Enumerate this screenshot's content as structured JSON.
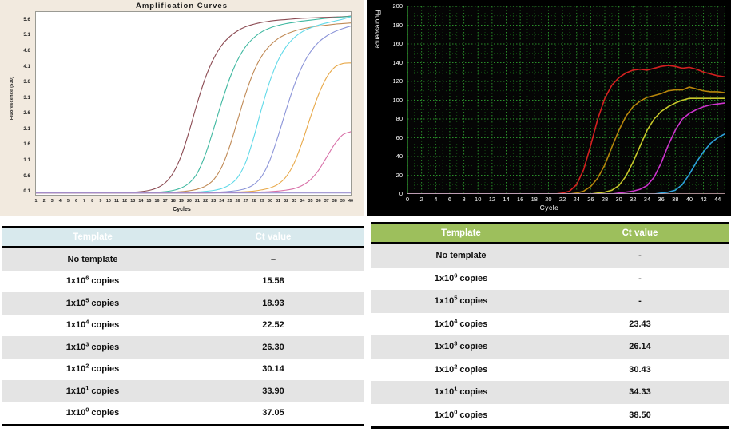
{
  "left": {
    "chart": {
      "title": "Amplification Curves",
      "xlabel": "Cycles",
      "ylabel": "Fluorescence (530)"
    },
    "table": {
      "headers": [
        "Template",
        "Ct value"
      ],
      "rows": [
        {
          "template_base": "No template",
          "template_exp": "",
          "template_suffix": "",
          "ct": "–"
        },
        {
          "template_base": "1x10",
          "template_exp": "6",
          "template_suffix": " copies",
          "ct": "15.58"
        },
        {
          "template_base": "1x10",
          "template_exp": "5",
          "template_suffix": " copies",
          "ct": "18.93"
        },
        {
          "template_base": "1x10",
          "template_exp": "4",
          "template_suffix": " copies",
          "ct": "22.52"
        },
        {
          "template_base": "1x10",
          "template_exp": "3",
          "template_suffix": " copies",
          "ct": "26.30"
        },
        {
          "template_base": "1x10",
          "template_exp": "2",
          "template_suffix": " copies",
          "ct": "30.14"
        },
        {
          "template_base": "1x10",
          "template_exp": "1",
          "template_suffix": " copies",
          "ct": "33.90"
        },
        {
          "template_base": "1x10",
          "template_exp": "0",
          "template_suffix": " copies",
          "ct": "37.05"
        }
      ],
      "header_bg": "#d8e9ed",
      "header_text_color": "#ffffff"
    }
  },
  "right": {
    "chart": {
      "title": "",
      "xlabel": "Cycle",
      "ylabel": "Fluorescence"
    },
    "table": {
      "headers": [
        "Template",
        "Ct value"
      ],
      "rows": [
        {
          "template_base": "No  template",
          "template_exp": "",
          "template_suffix": "",
          "ct": "-"
        },
        {
          "template_base": "1x10",
          "template_exp": "6",
          "template_suffix": " copies",
          "ct": "-"
        },
        {
          "template_base": "1x10",
          "template_exp": "5",
          "template_suffix": " copies",
          "ct": "-"
        },
        {
          "template_base": "1x10",
          "template_exp": "4",
          "template_suffix": " copies",
          "ct": "23.43"
        },
        {
          "template_base": "1x10",
          "template_exp": "3",
          "template_suffix": " copies",
          "ct": "26.14"
        },
        {
          "template_base": "1x10",
          "template_exp": "2",
          "template_suffix": " copies",
          "ct": "30.43"
        },
        {
          "template_base": "1x10",
          "template_exp": "1",
          "template_suffix": " copies",
          "ct": "34.33"
        },
        {
          "template_base": "1x10",
          "template_exp": "0",
          "template_suffix": " copies",
          "ct": "38.50"
        }
      ],
      "header_bg": "#9dbf5c",
      "header_text_color": "#ffffff"
    }
  },
  "chart_data": [
    {
      "type": "line",
      "id": "left-amplification-curves",
      "title": "Amplification Curves",
      "xlabel": "Cycles",
      "ylabel": "Fluorescence (530)",
      "xlim": [
        1,
        40
      ],
      "ylim": [
        0.0,
        5.85
      ],
      "grid": false,
      "legend": "none",
      "background": "#ffffff",
      "panel_background": "#f2eadf",
      "xticks": [
        1,
        2,
        3,
        4,
        5,
        6,
        7,
        8,
        9,
        10,
        11,
        12,
        13,
        14,
        15,
        16,
        17,
        18,
        19,
        20,
        21,
        22,
        23,
        24,
        25,
        26,
        27,
        28,
        29,
        30,
        31,
        32,
        33,
        34,
        35,
        36,
        37,
        38,
        39,
        40
      ],
      "yticks": [
        0.1,
        0.6,
        1.1,
        1.6,
        2.1,
        2.6,
        3.1,
        3.6,
        4.1,
        4.6,
        5.1,
        5.6
      ],
      "x": [
        1,
        2,
        3,
        4,
        5,
        6,
        7,
        8,
        9,
        10,
        11,
        12,
        13,
        14,
        15,
        16,
        17,
        18,
        19,
        20,
        21,
        22,
        23,
        24,
        25,
        26,
        27,
        28,
        29,
        30,
        31,
        32,
        33,
        34,
        35,
        36,
        37,
        38,
        39,
        40
      ],
      "series": [
        {
          "name": "1x10^6 copies",
          "color": "#8b4a52",
          "ct": 15.58,
          "values": [
            0.06,
            0.06,
            0.06,
            0.06,
            0.06,
            0.06,
            0.06,
            0.06,
            0.06,
            0.06,
            0.06,
            0.07,
            0.08,
            0.1,
            0.14,
            0.22,
            0.38,
            0.7,
            1.25,
            2.05,
            2.95,
            3.75,
            4.35,
            4.78,
            5.06,
            5.25,
            5.38,
            5.46,
            5.52,
            5.56,
            5.59,
            5.61,
            5.63,
            5.65,
            5.66,
            5.67,
            5.68,
            5.69,
            5.7,
            5.72
          ]
        },
        {
          "name": "1x10^5 copies",
          "color": "#3fb8a0",
          "ct": 18.93,
          "values": [
            0.06,
            0.06,
            0.06,
            0.06,
            0.06,
            0.06,
            0.06,
            0.06,
            0.06,
            0.06,
            0.06,
            0.06,
            0.06,
            0.06,
            0.07,
            0.08,
            0.1,
            0.14,
            0.22,
            0.38,
            0.7,
            1.3,
            2.1,
            2.95,
            3.72,
            4.32,
            4.75,
            5.03,
            5.22,
            5.34,
            5.42,
            5.48,
            5.52,
            5.56,
            5.59,
            5.62,
            5.65,
            5.67,
            5.69,
            5.71
          ]
        },
        {
          "name": "1x10^4 copies",
          "color": "#c08a56",
          "ct": 22.52,
          "values": [
            0.06,
            0.06,
            0.06,
            0.06,
            0.06,
            0.06,
            0.06,
            0.06,
            0.06,
            0.06,
            0.06,
            0.06,
            0.06,
            0.06,
            0.06,
            0.06,
            0.07,
            0.08,
            0.1,
            0.13,
            0.18,
            0.28,
            0.48,
            0.88,
            1.55,
            2.4,
            3.25,
            3.95,
            4.45,
            4.78,
            5.0,
            5.14,
            5.24,
            5.31,
            5.36,
            5.4,
            5.43,
            5.46,
            5.48,
            5.5
          ]
        },
        {
          "name": "1x10^3 copies",
          "color": "#5fd9e8",
          "ct": 26.3,
          "values": [
            0.06,
            0.06,
            0.06,
            0.06,
            0.06,
            0.06,
            0.06,
            0.06,
            0.06,
            0.06,
            0.06,
            0.06,
            0.06,
            0.06,
            0.06,
            0.06,
            0.06,
            0.06,
            0.07,
            0.08,
            0.09,
            0.11,
            0.14,
            0.2,
            0.32,
            0.56,
            1.05,
            1.85,
            2.8,
            3.65,
            4.3,
            4.74,
            5.03,
            5.22,
            5.34,
            5.43,
            5.5,
            5.56,
            5.62,
            5.7
          ]
        },
        {
          "name": "1x10^2 copies",
          "color": "#8b94d8",
          "ct": 30.14,
          "values": [
            0.06,
            0.06,
            0.06,
            0.06,
            0.06,
            0.06,
            0.06,
            0.06,
            0.06,
            0.06,
            0.06,
            0.06,
            0.06,
            0.06,
            0.06,
            0.06,
            0.06,
            0.06,
            0.06,
            0.06,
            0.07,
            0.07,
            0.08,
            0.09,
            0.11,
            0.14,
            0.2,
            0.33,
            0.6,
            1.12,
            1.88,
            2.72,
            3.5,
            4.12,
            4.57,
            4.88,
            5.08,
            5.22,
            5.32,
            5.4
          ]
        },
        {
          "name": "1x10^1 copies",
          "color": "#e8a94a",
          "ct": 33.9,
          "values": [
            0.06,
            0.06,
            0.06,
            0.06,
            0.06,
            0.06,
            0.06,
            0.06,
            0.06,
            0.06,
            0.06,
            0.06,
            0.06,
            0.06,
            0.06,
            0.06,
            0.06,
            0.06,
            0.06,
            0.06,
            0.06,
            0.06,
            0.07,
            0.07,
            0.08,
            0.09,
            0.1,
            0.12,
            0.16,
            0.22,
            0.34,
            0.58,
            1.02,
            1.7,
            2.48,
            3.2,
            3.75,
            4.08,
            4.2,
            4.22
          ]
        },
        {
          "name": "1x10^0 copies",
          "color": "#d870a8",
          "ct": 37.05,
          "values": [
            0.06,
            0.06,
            0.06,
            0.06,
            0.06,
            0.06,
            0.06,
            0.06,
            0.06,
            0.06,
            0.06,
            0.06,
            0.06,
            0.06,
            0.06,
            0.06,
            0.06,
            0.06,
            0.06,
            0.06,
            0.06,
            0.06,
            0.06,
            0.07,
            0.07,
            0.07,
            0.08,
            0.08,
            0.09,
            0.1,
            0.12,
            0.15,
            0.2,
            0.3,
            0.48,
            0.78,
            1.2,
            1.62,
            1.92,
            2.02
          ]
        },
        {
          "name": "No template",
          "color": "#9a8fcf",
          "ct": null,
          "values": [
            0.06,
            0.06,
            0.06,
            0.06,
            0.06,
            0.06,
            0.06,
            0.06,
            0.06,
            0.06,
            0.06,
            0.06,
            0.06,
            0.06,
            0.06,
            0.06,
            0.06,
            0.06,
            0.06,
            0.06,
            0.06,
            0.06,
            0.06,
            0.06,
            0.06,
            0.06,
            0.06,
            0.06,
            0.06,
            0.06,
            0.06,
            0.06,
            0.06,
            0.06,
            0.06,
            0.06,
            0.06,
            0.06,
            0.06,
            0.06
          ]
        }
      ]
    },
    {
      "type": "line",
      "id": "right-amplification-curves",
      "title": "",
      "xlabel": "Cycle",
      "ylabel": "Fluorescence",
      "xlim": [
        0,
        45
      ],
      "ylim": [
        0,
        200
      ],
      "grid": true,
      "grid_color": "#1f7a1f",
      "grid_style": "dotted",
      "legend": "none",
      "background": "#000000",
      "xticks": [
        0,
        2,
        4,
        6,
        8,
        10,
        12,
        14,
        16,
        18,
        20,
        22,
        24,
        26,
        28,
        30,
        32,
        34,
        36,
        38,
        40,
        42,
        44
      ],
      "yticks": [
        0,
        20,
        40,
        60,
        80,
        100,
        120,
        140,
        160,
        180,
        200
      ],
      "x": [
        0,
        1,
        2,
        3,
        4,
        5,
        6,
        7,
        8,
        9,
        10,
        11,
        12,
        13,
        14,
        15,
        16,
        17,
        18,
        19,
        20,
        21,
        22,
        23,
        24,
        25,
        26,
        27,
        28,
        29,
        30,
        31,
        32,
        33,
        34,
        35,
        36,
        37,
        38,
        39,
        40,
        41,
        42,
        43,
        44,
        45
      ],
      "series": [
        {
          "name": "1x10^4 copies",
          "color": "#d42020",
          "ct": 23.43,
          "values": [
            0,
            0,
            0,
            0,
            0,
            0,
            0,
            0,
            0,
            0,
            0,
            0,
            0,
            0,
            0,
            0,
            0,
            0,
            0,
            0,
            0,
            0,
            1,
            3,
            10,
            26,
            52,
            80,
            102,
            116,
            124,
            129,
            132,
            133,
            132,
            134,
            136,
            137,
            136,
            134,
            135,
            133,
            130,
            128,
            126,
            125
          ]
        },
        {
          "name": "1x10^3 copies",
          "color": "#b8860b",
          "ct": 26.14,
          "values": [
            0,
            0,
            0,
            0,
            0,
            0,
            0,
            0,
            0,
            0,
            0,
            0,
            0,
            0,
            0,
            0,
            0,
            0,
            0,
            0,
            0,
            0,
            0,
            0,
            1,
            3,
            8,
            17,
            31,
            50,
            68,
            83,
            93,
            99,
            103,
            105,
            107,
            110,
            111,
            111,
            114,
            112,
            110,
            109,
            109,
            108
          ]
        },
        {
          "name": "1x10^2 copies",
          "color": "#c8c82a",
          "ct": 30.43,
          "values": [
            0,
            0,
            0,
            0,
            0,
            0,
            0,
            0,
            0,
            0,
            0,
            0,
            0,
            0,
            0,
            0,
            0,
            0,
            0,
            0,
            0,
            0,
            0,
            0,
            0,
            0,
            0,
            1,
            2,
            4,
            9,
            19,
            34,
            51,
            68,
            80,
            88,
            93,
            97,
            100,
            102,
            102,
            102,
            102,
            102,
            102
          ]
        },
        {
          "name": "1x10^1 copies",
          "color": "#cc33cc",
          "ct": 34.33,
          "values": [
            0,
            0,
            0,
            0,
            0,
            0,
            0,
            0,
            0,
            0,
            0,
            0,
            0,
            0,
            0,
            0,
            0,
            0,
            0,
            0,
            0,
            0,
            0,
            0,
            0,
            0,
            0,
            0,
            0,
            0,
            1,
            2,
            3,
            5,
            9,
            18,
            33,
            52,
            68,
            80,
            86,
            90,
            93,
            95,
            96,
            97
          ]
        },
        {
          "name": "1x10^0 copies",
          "color": "#2b9fd8",
          "ct": 38.5,
          "values": [
            0,
            0,
            0,
            0,
            0,
            0,
            0,
            0,
            0,
            0,
            0,
            0,
            0,
            0,
            0,
            0,
            0,
            0,
            0,
            0,
            0,
            0,
            0,
            0,
            0,
            0,
            0,
            0,
            0,
            0,
            0,
            0,
            0,
            0,
            0,
            0,
            1,
            2,
            4,
            10,
            21,
            34,
            45,
            54,
            60,
            64
          ]
        },
        {
          "name": "No template / 1x10^6 / 1x10^5",
          "color": "#d8a8b8",
          "ct": null,
          "values": [
            0,
            0,
            0,
            0,
            0,
            0,
            0,
            0,
            0,
            0,
            0,
            0,
            0,
            0,
            0,
            0,
            0,
            0,
            0,
            0,
            0,
            0,
            0,
            0,
            0,
            0,
            0,
            0,
            0,
            0,
            0,
            0,
            0,
            0,
            0,
            0,
            0,
            0,
            0,
            0,
            0,
            0,
            0,
            0,
            0,
            0
          ]
        }
      ]
    }
  ]
}
